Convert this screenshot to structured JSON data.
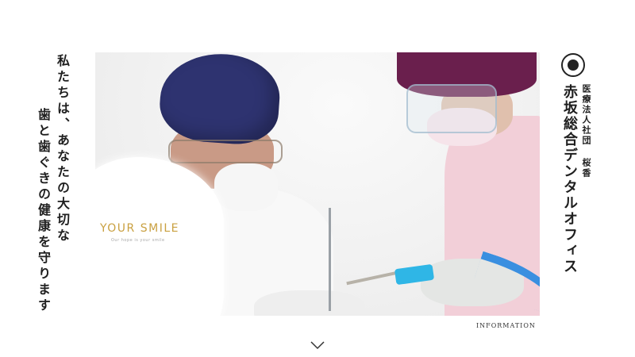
{
  "tagline": {
    "line1": "私たちは、あなたの大切な",
    "line2": "歯と歯ぐきの健康を守ります"
  },
  "clinic": {
    "corporation": "医療法人社団 桜香",
    "name": "赤坂総合デンタルオフィス"
  },
  "hero": {
    "logo_main": "YOUR SMILE",
    "logo_sub": "Our hope is your smile"
  },
  "links": {
    "information": "INFORMATION"
  },
  "icons": {
    "scroll": "chevron-down-icon",
    "emblem": "clinic-emblem-icon"
  },
  "colors": {
    "logo_gold": "#c9a040",
    "cap_blue": "#2e3370",
    "cap_magenta": "#6a1f4d",
    "tube_blue": "#3a8fe0"
  }
}
